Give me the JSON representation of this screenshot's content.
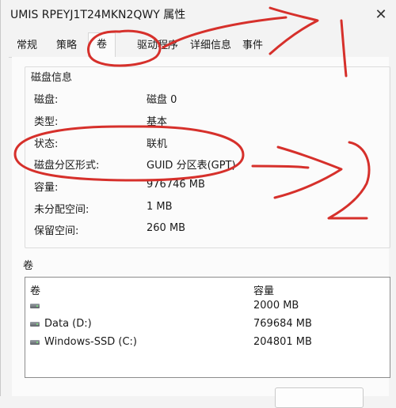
{
  "window": {
    "title": "UMIS RPEYJ1T24MKN2QWY 属性"
  },
  "tabs": [
    {
      "label": "常规"
    },
    {
      "label": "策略"
    },
    {
      "label": "卷"
    },
    {
      "label": "驱动程序"
    },
    {
      "label": "详细信息"
    },
    {
      "label": "事件"
    }
  ],
  "disk_info": {
    "group_title": "磁盘信息",
    "rows": [
      {
        "label": "磁盘:",
        "value": "磁盘 0"
      },
      {
        "label": "类型:",
        "value": "基本"
      },
      {
        "label": "状态:",
        "value": "联机"
      },
      {
        "label": "磁盘分区形式:",
        "value": "GUID 分区表(GPT)"
      },
      {
        "label": "容量:",
        "value": "976746 MB"
      },
      {
        "label": "未分配空间:",
        "value": "1 MB"
      },
      {
        "label": "保留空间:",
        "value": "260 MB"
      }
    ]
  },
  "volumes": {
    "heading": "卷",
    "columns": {
      "name": "卷",
      "capacity": "容量"
    },
    "rows": [
      {
        "name": "",
        "capacity": "2000 MB"
      },
      {
        "name": "Data (D:)",
        "capacity": "769684 MB"
      },
      {
        "name": "Windows-SSD (C:)",
        "capacity": "204801 MB"
      }
    ]
  },
  "icons": {
    "close": "close-icon",
    "volume": "disk-volume-icon"
  },
  "colors": {
    "annotation": "#d6302b"
  }
}
